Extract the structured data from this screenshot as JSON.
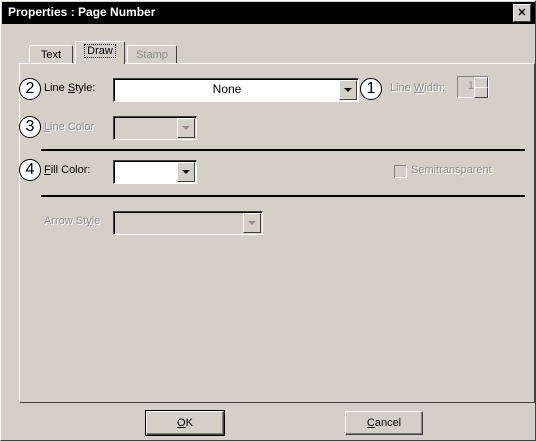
{
  "window": {
    "title": "Properties : Page Number",
    "close_label": "✕"
  },
  "tabs": [
    {
      "label": "Text",
      "state": "normal"
    },
    {
      "label": "Draw",
      "state": "active"
    },
    {
      "label": "Stamp",
      "state": "disabled"
    }
  ],
  "draw": {
    "line_style": {
      "label": "Line Style:",
      "value": "None",
      "callout": "2"
    },
    "line_width": {
      "label": "Line Width:",
      "value": "1",
      "callout": "1"
    },
    "line_color": {
      "label": "Line Color",
      "callout": "3"
    },
    "fill_color": {
      "label": "Fill Color:",
      "callout": "4"
    },
    "semitransparent": {
      "label": "Semitransparent",
      "checked": false
    },
    "arrow_style": {
      "label": "Arrow Style"
    }
  },
  "buttons": {
    "ok": "OK",
    "cancel": "Cancel"
  }
}
